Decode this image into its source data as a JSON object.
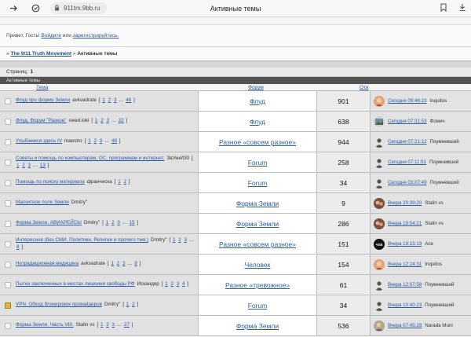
{
  "browser": {
    "url": "911tm.9bb.ru",
    "tab_title": "Активные темы"
  },
  "header": {
    "greeting": "Привет, Гость!",
    "login": "Войдите",
    "or": "или",
    "register": "зарегистрируйтесь."
  },
  "breadcrumb": {
    "forum": "The 9/11 Truth Movement",
    "separator": "»",
    "current": "Активные темы"
  },
  "pagination": {
    "label": "Страниц:",
    "current": "1"
  },
  "table": {
    "section_title": "Активные темы",
    "columns": {
      "topic": "Тема",
      "forum": "Форум",
      "replies": "Отв",
      "last_post": ""
    },
    "rows": [
      {
        "title": "Флуд про форму Земли",
        "author": "avkvadrate",
        "pages": [
          "1",
          "2",
          "3",
          "…",
          "46"
        ],
        "forum": "Флуд",
        "replies": "901",
        "last_date": "Сегодня 09:46:23",
        "last_user": "Inquitos",
        "avatar": "inquitos",
        "pinned": false
      },
      {
        "title": "Флуд. Форум \"Разное\"",
        "author": "swed.loki",
        "pages": [
          "1",
          "2",
          "3",
          "…",
          "32"
        ],
        "forum": "Флуд",
        "replies": "638",
        "last_date": "Сегодня 07:31:53",
        "last_user": "Фомич",
        "avatar": "fomich",
        "pinned": false
      },
      {
        "title": "Улыбаемся здесь IV",
        "author": "maestro",
        "pages": [
          "1",
          "2",
          "3",
          "…",
          "48"
        ],
        "forum": "Разное «совсем разное»",
        "replies": "944",
        "last_date": "Сегодня 07:21:12",
        "last_user": "Поумневший",
        "avatar": "silhouette",
        "pinned": false
      },
      {
        "title": "Советы и помощь по компьютерам, ОС, программам и интернет.",
        "author": "ЗвУкиИ30",
        "pages": [
          "1",
          "2",
          "3",
          "…",
          "13"
        ],
        "forum": "Forum",
        "replies": "258",
        "last_date": "Сегодня 07:11:51",
        "last_user": "Поумневший",
        "avatar": "silhouette",
        "pinned": false
      },
      {
        "title": "Помощь по поиску материала",
        "author": "франческа",
        "pages": [
          "1",
          "2"
        ],
        "forum": "Forum",
        "replies": "34",
        "last_date": "Сегодня 03:07:49",
        "last_user": "Поумневший",
        "avatar": "silhouette",
        "pinned": false
      },
      {
        "title": "Магнитное поле Земли",
        "author": "Dmitry\"",
        "pages": [],
        "forum": "Форма Земли",
        "replies": "9",
        "last_date": "Вчера 20:39:20",
        "last_user": "Stalin vs",
        "avatar": "stalin",
        "pinned": false
      },
      {
        "title": "Форма Земли. АВИАРЕЙСЫ",
        "author": "Dmitry\"",
        "pages": [
          "1",
          "2",
          "3",
          "…",
          "15"
        ],
        "forum": "Форма Земли",
        "replies": "286",
        "last_date": "Вчера 19:54:21",
        "last_user": "Stalin vs",
        "avatar": "stalin",
        "pinned": false
      },
      {
        "title": "Интересное (без СМИ, Политики, Религии и прочего тмя.)",
        "author": "Dmitry\"",
        "pages": [
          "1",
          "2",
          "3",
          "…",
          "8"
        ],
        "forum": "Разное «совсем разное»",
        "replies": "151",
        "last_date": "Вчера 19:15:19",
        "last_user": "Ace",
        "avatar": "ace",
        "pinned": false
      },
      {
        "title": "Нетрадиционная медицина",
        "author": "avkvadrate",
        "pages": [
          "1",
          "2",
          "3",
          "…",
          "8"
        ],
        "forum": "Человек",
        "replies": "154",
        "last_date": "Вчера 12:24:31",
        "last_user": "Inquitos",
        "avatar": "inquitos",
        "pinned": false
      },
      {
        "title": "Пытки заключенных в местах лишения свободы РФ",
        "author": "Искандер",
        "pages": [
          "1",
          "2",
          "3",
          "4"
        ],
        "forum": "Разное «тревожное»",
        "replies": "61",
        "last_date": "Вчера 12:07:58",
        "last_user": "Поумневший",
        "avatar": "silhouette",
        "pinned": false
      },
      {
        "title": "VPN. Обход блокировок провайдеров",
        "author": "Dmitry\"",
        "pages": [
          "1",
          "2"
        ],
        "forum": "Forum",
        "replies": "34",
        "last_date": "Вчера 10:40:23",
        "last_user": "Поумневший",
        "avatar": "silhouette",
        "pinned": true
      },
      {
        "title": "Форма Земли. Часть VIII.",
        "author": "Stalin vs",
        "pages": [
          "1",
          "2",
          "3",
          "…",
          "27"
        ],
        "forum": "Форма Земли",
        "replies": "536",
        "last_date": "Вчера 07:45:28",
        "last_user": "Narada Muni",
        "avatar": "narada",
        "pinned": false
      }
    ]
  },
  "colors": {
    "link": "#2b5aa8",
    "section_header_bg": "#525252",
    "pinned_icon": "#e2b740"
  },
  "avatar_text": {
    "ace": "ЧХВ"
  }
}
